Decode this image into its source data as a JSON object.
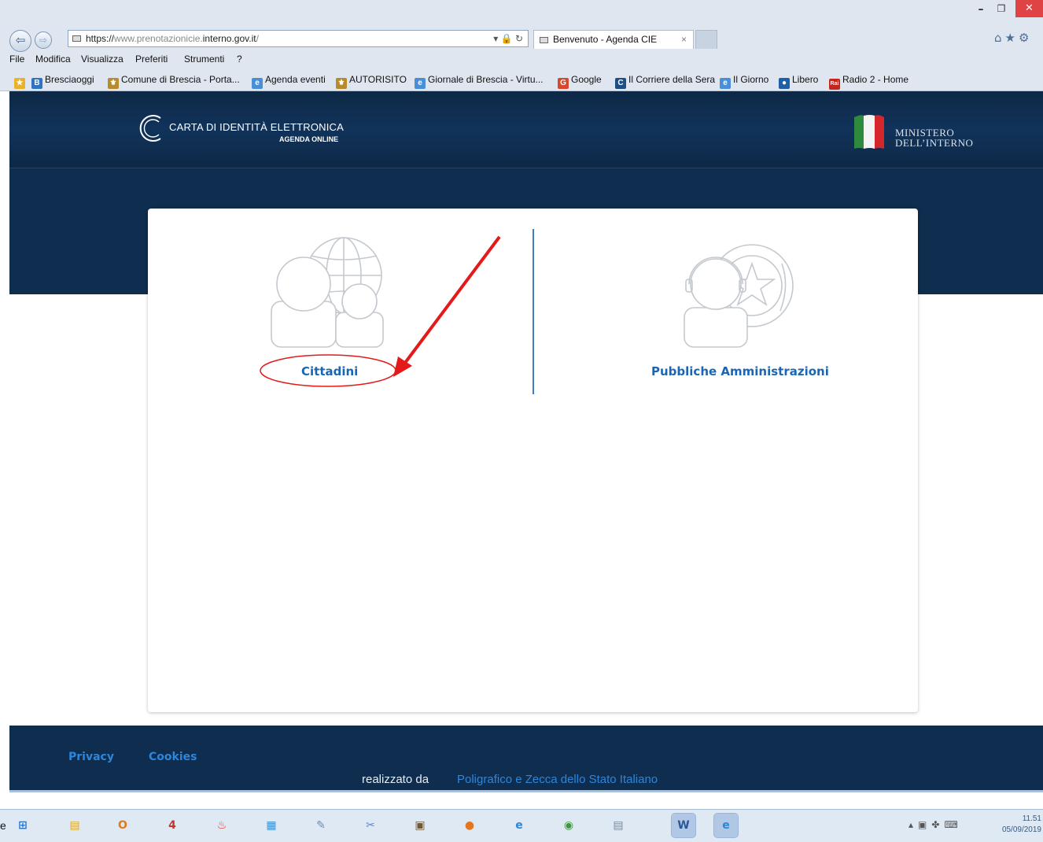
{
  "browser": {
    "url_prefix": "https://",
    "url_host_muted": "www.prenotazionicie.",
    "url_host_main": "interno.gov.it",
    "url_path": "/",
    "tab_title": "Benvenuto - Agenda CIE",
    "tab_close": "×",
    "menu": [
      "File",
      "Modifica",
      "Visualizza",
      "Preferiti",
      "Strumenti",
      "?"
    ],
    "favorites": [
      {
        "label": "Bresciaoggi",
        "icon": "B",
        "color": "#2f74c0"
      },
      {
        "label": "Comune di Brescia - Porta...",
        "icon": "⚜",
        "color": "#b78a2e"
      },
      {
        "label": "Agenda eventi",
        "icon": "e",
        "color": "#4a8fd6"
      },
      {
        "label": "AUTORISITO",
        "icon": "⚜",
        "color": "#b78a2e"
      },
      {
        "label": "Giornale di Brescia - Virtu...",
        "icon": "e",
        "color": "#4a8fd6"
      },
      {
        "label": "Google",
        "icon": "G",
        "color": "#d6492f"
      },
      {
        "label": "Il Corriere della Sera",
        "icon": "C",
        "color": "#1d4f86"
      },
      {
        "label": "Il Giorno",
        "icon": "e",
        "color": "#4a8fd6"
      },
      {
        "label": "Libero",
        "icon": "●",
        "color": "#1f5fa6"
      },
      {
        "label": "Radio 2 - Home",
        "icon": "Rai",
        "color": "#c4251f"
      }
    ]
  },
  "site": {
    "logo_title": "CARTA DI IDENTITÀ ELETTRONICA",
    "logo_subtitle": "AGENDA ONLINE",
    "ministry_line1": "MINISTERO",
    "ministry_line2": "DELL’INTERNO"
  },
  "choices": {
    "citizens_label": "Cittadini",
    "pa_label": "Pubbliche Amministrazioni"
  },
  "footer": {
    "privacy": "Privacy",
    "cookies": "Cookies",
    "credit_prefix": "realizzato da",
    "credit_link": "Poligrafico e Zecca dello Stato Italiano"
  },
  "taskbar": {
    "stray_char": "e",
    "time": "11.51",
    "date": "05/09/2019",
    "apps": [
      {
        "name": "start-icon",
        "glyph": "⊞",
        "color": "#2a74c8"
      },
      {
        "name": "file-explorer-icon",
        "glyph": "▤",
        "color": "#d6a93a"
      },
      {
        "name": "outlook-icon",
        "glyph": "O",
        "color": "#e07b1a"
      },
      {
        "name": "4id-app-icon",
        "glyph": "4",
        "color": "#c0392b"
      },
      {
        "name": "burn-app-icon",
        "glyph": "♨",
        "color": "#d6361f"
      },
      {
        "name": "control-panel-icon",
        "glyph": "▦",
        "color": "#3c8fcf"
      },
      {
        "name": "paint-icon",
        "glyph": "✎",
        "color": "#6b8bb5"
      },
      {
        "name": "snipping-tool-icon",
        "glyph": "✂",
        "color": "#5a87c2"
      },
      {
        "name": "media-app-icon",
        "glyph": "▣",
        "color": "#6c5a3a"
      },
      {
        "name": "firefox-icon",
        "glyph": "●",
        "color": "#e5761c"
      },
      {
        "name": "internet-explorer-icon",
        "glyph": "e",
        "color": "#2b86d4"
      },
      {
        "name": "chrome-icon",
        "glyph": "◉",
        "color": "#3a9a3a"
      },
      {
        "name": "calculator-icon",
        "glyph": "▤",
        "color": "#7a8a9a"
      },
      {
        "name": "word-icon",
        "glyph": "W",
        "color": "#2b5797"
      },
      {
        "name": "internet-explorer-active-icon",
        "glyph": "e",
        "color": "#2b86d4"
      }
    ]
  },
  "colors": {
    "header_navy": "#0f2d4f",
    "link_blue": "#1a66b5",
    "annotation_red": "#e41a1a"
  }
}
